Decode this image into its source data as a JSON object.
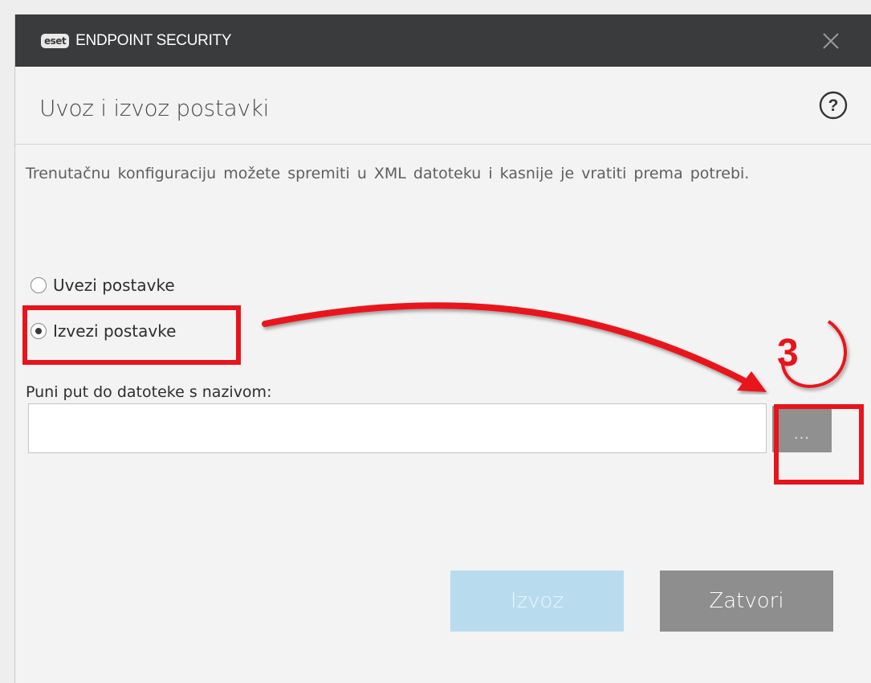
{
  "window": {
    "logo_text": "eset",
    "product_name": "ENDPOINT SECURITY",
    "close_icon": "close-icon"
  },
  "header": {
    "title": "Uvoz i izvoz postavki",
    "help_icon": "help-icon"
  },
  "main": {
    "description": "Trenutačnu konfiguraciju možete spremiti u XML datoteku i kasnije je vratiti prema potrebi.",
    "options": [
      {
        "label": "Uvezi postavke",
        "selected": false
      },
      {
        "label": "Izvezi postavke",
        "selected": true
      }
    ],
    "path_label": "Puni put do datoteke s nazivom:",
    "path_value": "",
    "browse_label": "..."
  },
  "footer": {
    "export_label": "Izvoz",
    "close_label": "Zatvori"
  },
  "annotation": {
    "step_number": "3",
    "color": "#e8141b"
  },
  "colors": {
    "titlebar": "#3a3b3d",
    "export_button": "#b8dcee",
    "close_button": "#8e8e8e"
  }
}
